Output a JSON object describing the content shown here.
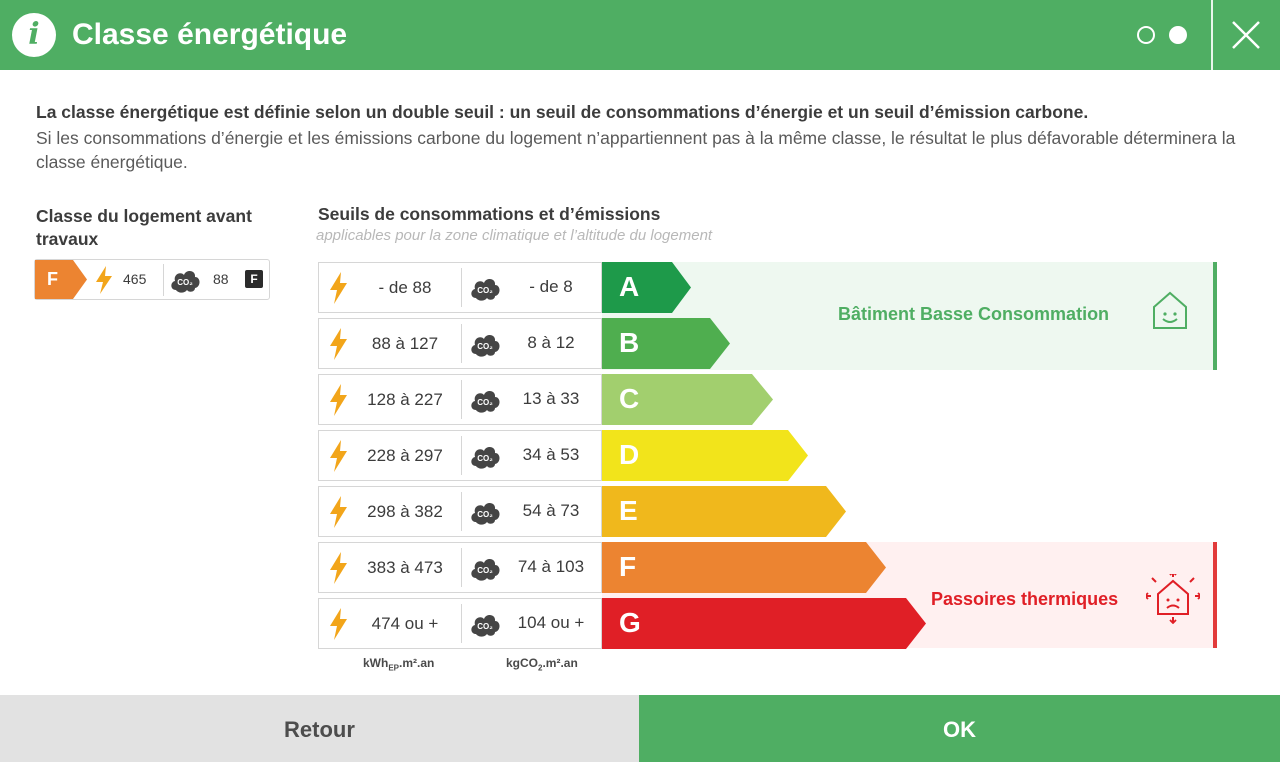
{
  "header": {
    "title": "Classe énergétique",
    "page_indicator": {
      "total": 2,
      "current": 2
    }
  },
  "intro": {
    "bold": "La classe énergétique est définie selon un double seuil : un seuil de consommations d’énergie et un seuil d’émission carbone.",
    "text": "Si les consommations d’énergie et les émissions carbone du logement n’appartiennent pas à la même classe, le résultat le plus défavorable déterminera la classe énergétique."
  },
  "current": {
    "title": "Classe du logement avant travaux",
    "class_letter": "F",
    "energy_value": "465",
    "co2_value": "88",
    "co2_class": "F"
  },
  "thresholds": {
    "title": "Seuils de consommations et d’émissions",
    "subtitle": "applicables pour la zone climatique et l’altitude du logement",
    "rows": [
      {
        "energy": "- de 88",
        "co2": "- de 8",
        "letter": "A",
        "color": "#1e9a4a"
      },
      {
        "energy": "88 à 127",
        "co2": "8 à 12",
        "letter": "B",
        "color": "#4fae4f"
      },
      {
        "energy": "128 à 227",
        "co2": "13 à 33",
        "letter": "C",
        "color": "#a2cf6e"
      },
      {
        "energy": "228 à 297",
        "co2": "34 à 53",
        "letter": "D",
        "color": "#f2e41b"
      },
      {
        "energy": "298 à 382",
        "co2": "54 à 73",
        "letter": "E",
        "color": "#f0b81c"
      },
      {
        "energy": "383 à 473",
        "co2": "74 à 103",
        "letter": "F",
        "color": "#ec8431"
      },
      {
        "energy": "474 ou +",
        "co2": "104 ou +",
        "letter": "G",
        "color": "#e01f26"
      }
    ],
    "units": {
      "energy": "kWh",
      "energy_sub": "EP",
      "energy_suffix": ".m².an",
      "co2": "kgCO",
      "co2_sub": "2",
      "co2_suffix": ".m².an"
    },
    "bbc_label": "Bâtiment Basse Consommation",
    "passoire_label": "Passoires thermiques",
    "bbc_color": "#4fae63",
    "passoire_color": "#e01f26"
  },
  "footer": {
    "back_label": "Retour",
    "ok_label": "OK"
  },
  "colors": {
    "primary_green": "#4fae63",
    "lightning_orange": "#f2a51a",
    "cloud_dark": "#454545"
  }
}
